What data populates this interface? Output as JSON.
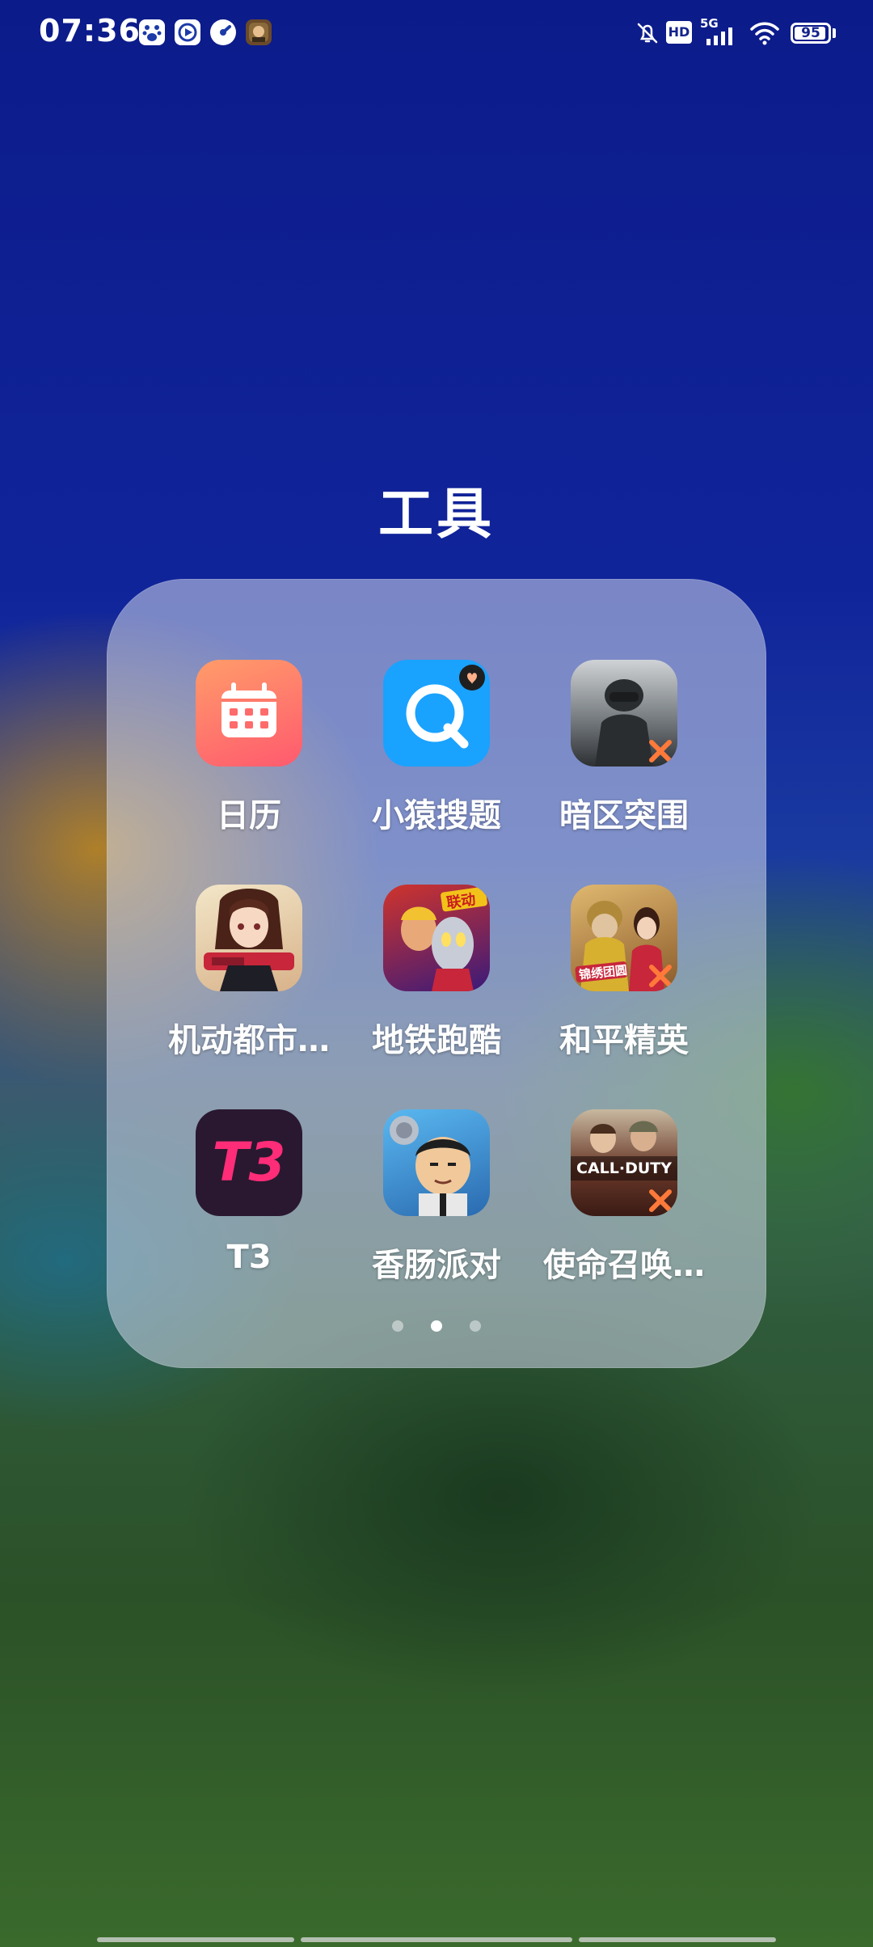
{
  "status_bar": {
    "time": "07:36",
    "notification_icons": [
      "baidu-icon",
      "video-player-icon",
      "speed-icon",
      "game-avatar-icon"
    ],
    "hd_label": "HD",
    "network": "5G",
    "battery_level": "95",
    "battery_percent": 0.95
  },
  "folder": {
    "title": "工具",
    "apps": [
      {
        "label": "日历",
        "icon": "calendar-icon"
      },
      {
        "label": "小猿搜题",
        "icon": "search-q-icon"
      },
      {
        "label": "暗区突围",
        "icon": "soldier-icon"
      },
      {
        "label": "机动都市…",
        "icon": "anime-girl-icon"
      },
      {
        "label": "地铁跑酷",
        "icon": "subway-runner-icon"
      },
      {
        "label": "和平精英",
        "icon": "peace-elite-icon"
      },
      {
        "label": "T3",
        "icon": "t3-icon",
        "text": "T3"
      },
      {
        "label": "香肠派对",
        "icon": "sausage-party-icon"
      },
      {
        "label": "使命召唤…",
        "icon": "call-of-duty-icon",
        "text": "CALL·DUTY"
      }
    ],
    "pages": 3,
    "current_page": 2
  },
  "colors": {
    "calendar": "#ff6b6b",
    "search_blue": "#1aa2ff",
    "t3_bg": "#2a1830",
    "t3_pink": "#ff2d78"
  }
}
